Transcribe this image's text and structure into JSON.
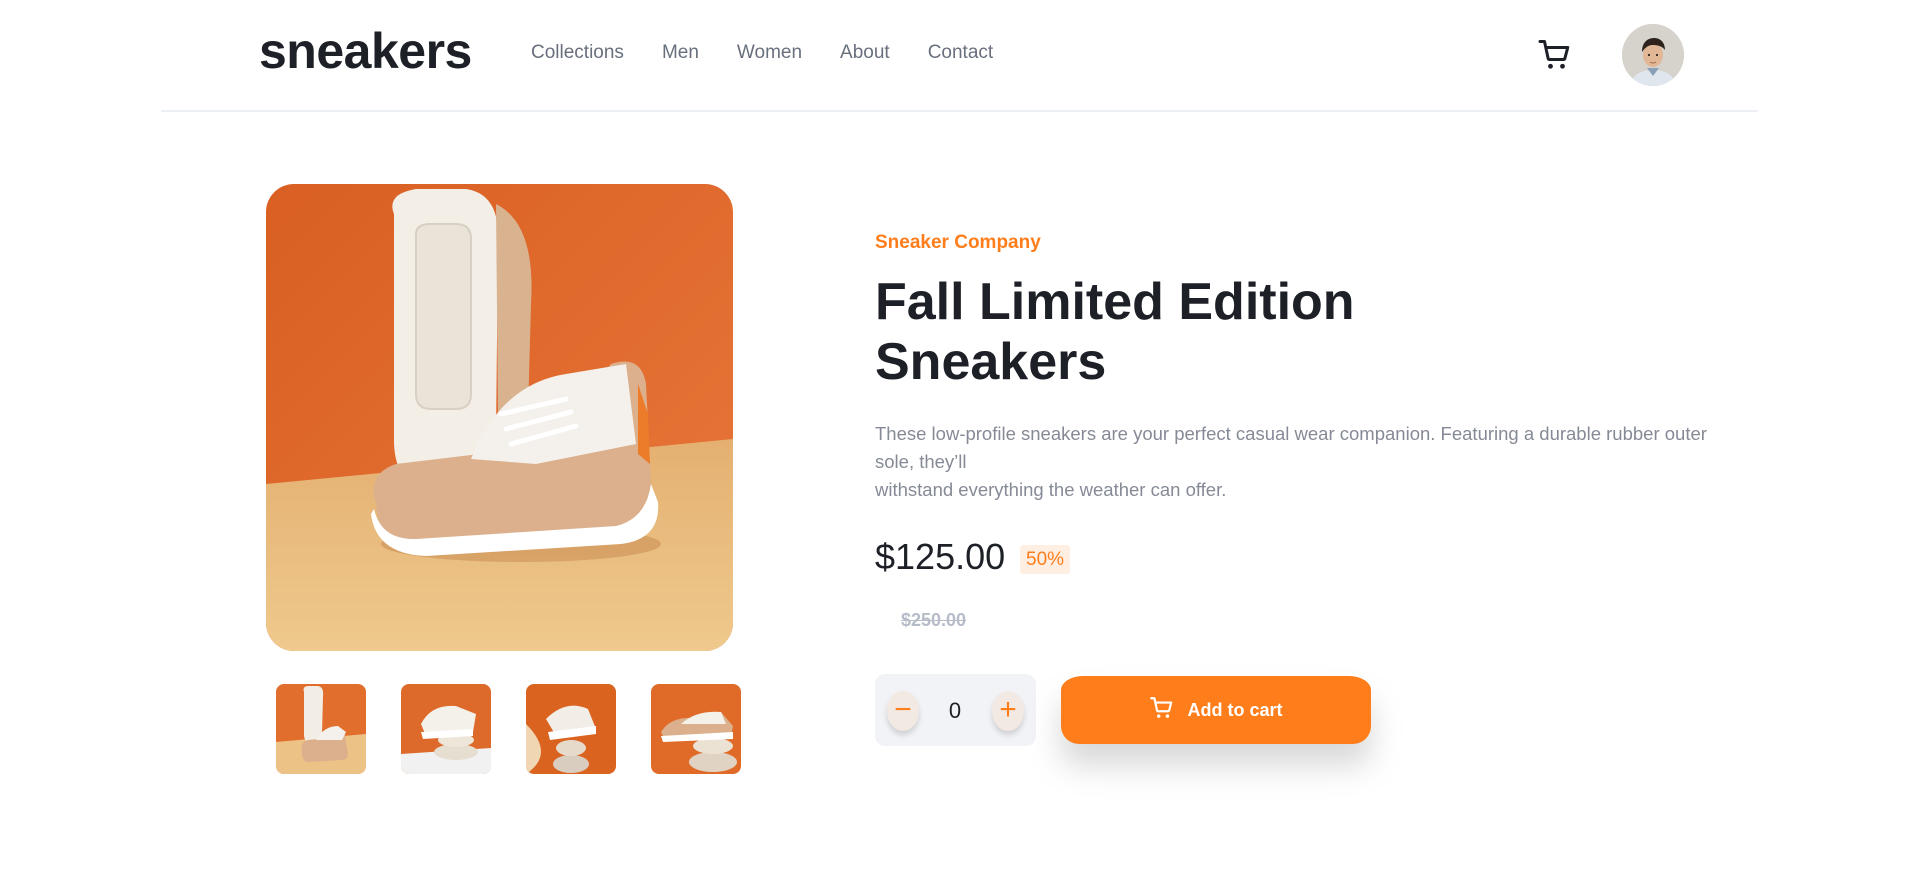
{
  "header": {
    "logo": "sneakers",
    "nav": [
      "Collections",
      "Men",
      "Women",
      "About",
      "Contact"
    ],
    "cart_icon": "cart-icon",
    "avatar_icon": "avatar"
  },
  "product": {
    "company": "Sneaker Company",
    "title_line1": "Fall Limited Edition",
    "title_line2": "Sneakers",
    "description_line1": "These low-profile sneakers are your perfect casual wear companion. Featuring a durable rubber outer",
    "description_line2": "sole, they’ll",
    "description_line3": "withstand everything the weather can offer.",
    "price": "$125.00",
    "discount": "50%",
    "old_price": "$250.00",
    "quantity": "0",
    "minus_label": "−",
    "plus_label": "+",
    "add_to_cart": "Add to cart"
  },
  "gallery": {
    "thumbnail_count": 4
  },
  "colors": {
    "accent": "#ff7e1b",
    "accent_pale": "#ffeee2",
    "text_dark": "#1d2026",
    "text_muted": "#69707d",
    "product_bg": "#e56f2b",
    "floor_bg": "#efc889"
  }
}
